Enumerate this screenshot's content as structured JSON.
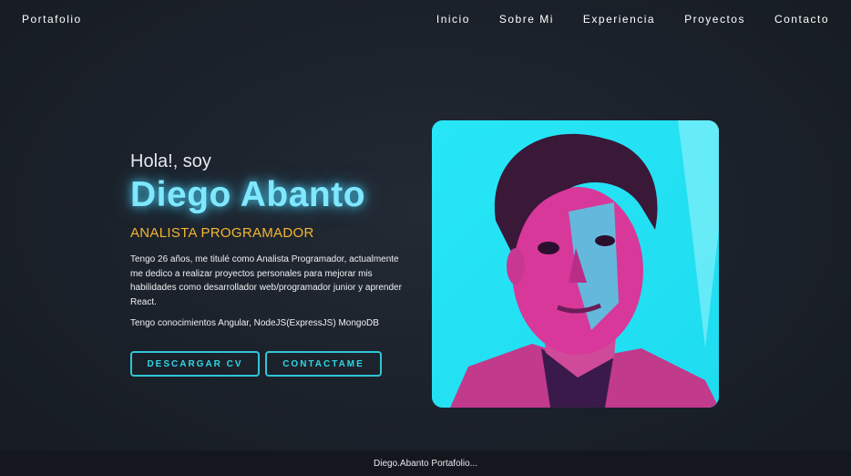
{
  "nav": {
    "brand": "Portafolio",
    "items": [
      {
        "label": "Inicio"
      },
      {
        "label": "Sobre Mi"
      },
      {
        "label": "Experiencia"
      },
      {
        "label": "Proyectos"
      },
      {
        "label": "Contacto"
      }
    ]
  },
  "hero": {
    "greeting": "Hola!, soy",
    "name": "Diego Abanto",
    "role": "ANALISTA PROGRAMADOR",
    "description": "Tengo 26 años, me titulé como Analista Programador, actualmente me dedico a realizar proyectos personales para mejorar mis habilidades como desarrollador web/programador junior y aprender React.",
    "skills": "Tengo conocimientos Angular, NodeJS(ExpressJS) MongoDB",
    "buttons": {
      "download_cv": "DESCARGAR CV",
      "contact": "CONTACTAME"
    }
  },
  "photo": {
    "icon": "profile-photo"
  },
  "footer": {
    "text": "Diego.Abanto Portafolio..."
  },
  "colors": {
    "accent_cyan": "#7fe8ff",
    "button_cyan": "#2fc6d6",
    "role_gold": "#f2b632",
    "photo_pink": "#d8308a"
  }
}
